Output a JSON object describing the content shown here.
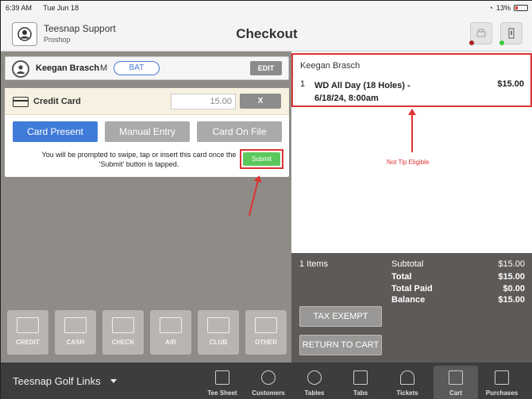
{
  "status": {
    "time": "6:39 AM",
    "date": "Tue Jun 18",
    "battery": "13%"
  },
  "header": {
    "user_name": "Teesnap Support",
    "user_role": "Proshop",
    "title": "Checkout"
  },
  "customer": {
    "name": "Keegan Brasch",
    "gender": "M",
    "tag": "BAT",
    "edit_label": "EDIT"
  },
  "credit_card": {
    "title": "Credit Card",
    "amount_placeholder": "15.00",
    "clear_label": "X",
    "modes": [
      "Card Present",
      "Manual Entry",
      "Card On File"
    ],
    "message": "You will be prompted to swipe, tap or insert this card once the 'Submit' button is tapped.",
    "submit_label": "Submit"
  },
  "payment_methods": [
    "CREDIT",
    "CASH",
    "CHECK",
    "A/R",
    "CLUB",
    "OTHER"
  ],
  "order": {
    "customer": "Keegan Brasch",
    "qty": "1",
    "item": "WD All Day (18 Holes) - 6/18/24, 8:00am",
    "price": "$15.00",
    "annotation": "Not Tip Eligible"
  },
  "totals": {
    "items": "1 Items",
    "subtotal_label": "Subtotal",
    "subtotal": "$15.00",
    "total_label": "Total",
    "total": "$15.00",
    "paid_label": "Total Paid",
    "paid": "$0.00",
    "balance_label": "Balance",
    "balance": "$15.00",
    "tax_exempt": "TAX EXEMPT",
    "return_to_cart": "RETURN TO CART"
  },
  "bottom": {
    "course": "Teesnap Golf Links",
    "nav": [
      "Tee Sheet",
      "Customers",
      "Tables",
      "Tabs",
      "Tickets",
      "Cart",
      "Purchases"
    ],
    "active": "Cart"
  },
  "colors": {
    "accent": "#3f7bd9",
    "submit": "#5cc85c",
    "annotation": "#dd3333"
  }
}
